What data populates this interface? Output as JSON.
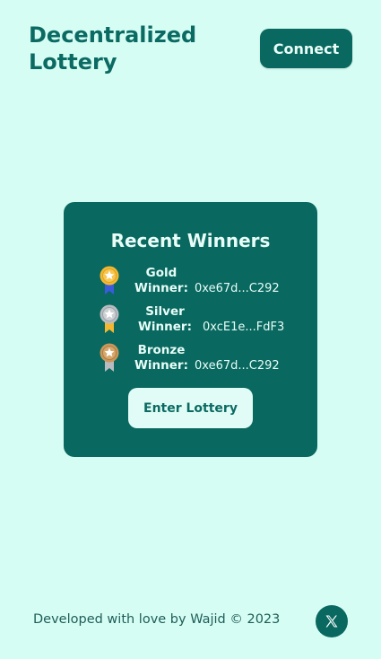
{
  "header": {
    "title": "Decentralized Lottery",
    "connect_label": "Connect"
  },
  "card": {
    "title": "Recent Winners",
    "winners": [
      {
        "rank": "Gold",
        "label_suffix": "Winner:",
        "address": "0xe67d...C292",
        "medal_icon": "gold-medal-icon",
        "medal_color": "#f4b731",
        "ribbon_color": "#3b5bdb"
      },
      {
        "rank": "Silver",
        "label_suffix": "Winner:",
        "address": "0xcE1e...FdF3",
        "medal_icon": "silver-medal-icon",
        "medal_color": "#b8bcc0",
        "ribbon_color": "#f4b731"
      },
      {
        "rank": "Bronze",
        "label_suffix": "Winner:",
        "address": "0xe67d...C292",
        "medal_icon": "bronze-medal-icon",
        "medal_color": "#c9975a",
        "ribbon_color": "#b8bcc0"
      }
    ],
    "enter_label": "Enter Lottery"
  },
  "footer": {
    "text": "Developed with love by Wajid © 2023",
    "social_icon": "x-logo-icon"
  },
  "colors": {
    "background": "#d6fdf4",
    "primary": "#09685f",
    "text_light": "#e8fdf8"
  }
}
